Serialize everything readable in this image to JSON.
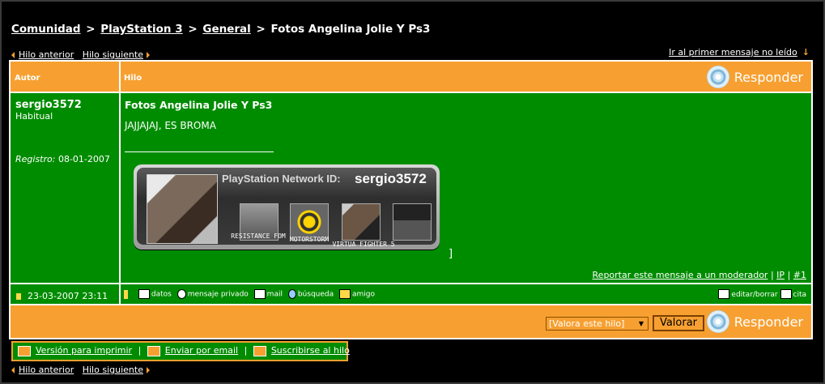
{
  "breadcrumb": {
    "items": [
      "Comunidad",
      "PlayStation 3",
      "General"
    ],
    "separator": ">",
    "current": "Fotos Angelina Jolie Y Ps3"
  },
  "nav": {
    "prev": "Hilo anterior",
    "next": "Hilo siguiente",
    "first_unread": "Ir al primer mensaje no leído"
  },
  "table": {
    "col_author": "Autor",
    "col_thread": "Hilo",
    "reply_label": "Responder"
  },
  "post": {
    "author": "sergio3572",
    "rank": "Habitual",
    "reg_label": "Registro:",
    "reg_date": "08-01-2007",
    "title": "Fotos Angelina Jolie Y Ps3",
    "body": "JAJJAJAJ, ES BROMA",
    "trailing": "]",
    "date": "23-03-2007 23:11",
    "report": "Reportar este mensaje a un moderador",
    "ip": "IP",
    "num": "#1"
  },
  "psn": {
    "label": "PlayStation Network ID:",
    "id": "sergio3572",
    "games": [
      "RESISTANCE FOM",
      "MOTORSTORM",
      "VIRTUA FIGHTER 5"
    ]
  },
  "tools": {
    "datos": "datos",
    "mensaje": "mensaje privado",
    "mail": "mail",
    "busqueda": "búsqueda",
    "amigo": "amigo",
    "editar": "editar/borrar",
    "cita": "cita"
  },
  "footer": {
    "rate_placeholder": "[Valora este hilo]",
    "rate_button": "Valorar",
    "print": "Versión para imprimir",
    "email": "Enviar por email",
    "subscribe": "Suscribirse al hilo"
  },
  "colors": {
    "orange": "#f7a031",
    "green": "#008c00",
    "background": "#000000"
  }
}
